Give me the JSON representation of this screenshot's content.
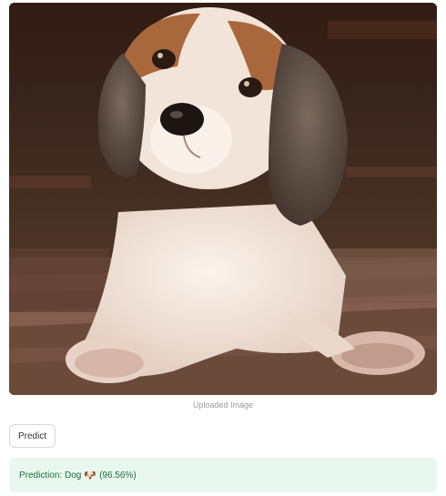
{
  "image": {
    "caption": "Uploaded Image",
    "subject": "beagle puppy photo"
  },
  "predict_button": {
    "label": "Predict"
  },
  "result": {
    "prefix": "Prediction: Dog",
    "emoji": "🐶",
    "confidence": "(96.56%)"
  },
  "colors": {
    "success_background": "#e9f8ee",
    "success_text": "#1f6b3c",
    "caption_text": "#9a9ca3",
    "button_border": "#d5d6db"
  }
}
